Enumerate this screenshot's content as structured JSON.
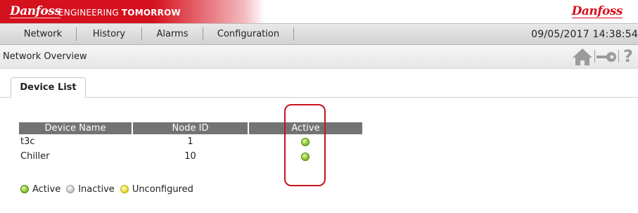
{
  "brand": {
    "logo_text": "Danfoss",
    "tagline_part1": "ENGINEERING ",
    "tagline_part2": "TOMORROW",
    "primary_color": "#d6111e"
  },
  "menu": {
    "items": [
      {
        "label": "Network"
      },
      {
        "label": "History"
      },
      {
        "label": "Alarms"
      },
      {
        "label": "Configuration"
      }
    ],
    "datetime": "09/05/2017 14:38:54"
  },
  "subheader": {
    "title": "Network Overview",
    "icons": [
      "home-icon",
      "key-icon",
      "help-icon"
    ],
    "help_glyph": "?"
  },
  "tabs": [
    {
      "label": "Device List",
      "selected": true
    }
  ],
  "device_table": {
    "headers": [
      "Device Name",
      "Node ID",
      "Active"
    ],
    "rows": [
      {
        "name": "t3c",
        "node_id": "1",
        "status": "active"
      },
      {
        "name": "Chiller",
        "node_id": "10",
        "status": "active"
      }
    ]
  },
  "legend": {
    "items": [
      {
        "label": "Active",
        "color": "#8cc63f"
      },
      {
        "label": "Inactive",
        "color": "#c0c0c0"
      },
      {
        "label": "Unconfigured",
        "color": "#e6dc3a"
      }
    ]
  },
  "annotation": {
    "color": "#c8141e",
    "target": "Active column"
  }
}
